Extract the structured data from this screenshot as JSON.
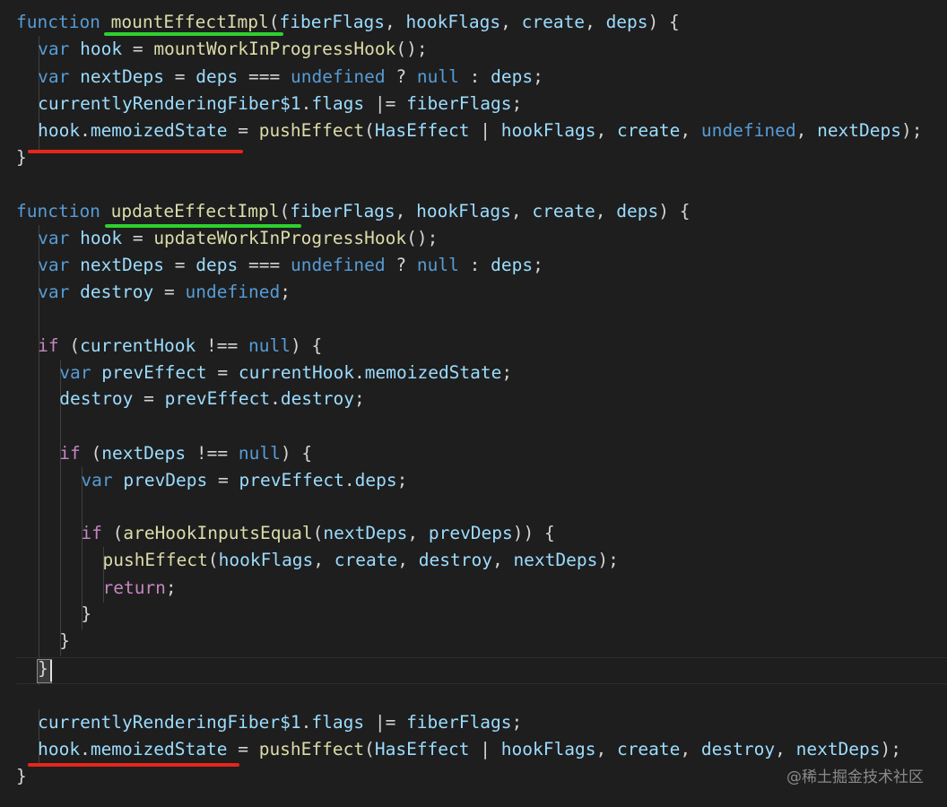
{
  "editor": {
    "lines": [
      {
        "text": "function mountEffectImpl(fiberFlags, hookFlags, create, deps) {"
      },
      {
        "text": "var hook = mountWorkInProgressHook();"
      },
      {
        "text": "var nextDeps = deps === undefined ? null : deps;"
      },
      {
        "text": "currentlyRenderingFiber$1.flags |= fiberFlags;"
      },
      {
        "text": "hook.memoizedState = pushEffect(HasEffect | hookFlags, create, undefined, nextDeps);"
      },
      {
        "text": "}"
      },
      {
        "text": ""
      },
      {
        "text": "function updateEffectImpl(fiberFlags, hookFlags, create, deps) {"
      },
      {
        "text": "var hook = updateWorkInProgressHook();"
      },
      {
        "text": "var nextDeps = deps === undefined ? null : deps;"
      },
      {
        "text": "var destroy = undefined;"
      },
      {
        "text": ""
      },
      {
        "text": "if (currentHook !== null) {"
      },
      {
        "text": "var prevEffect = currentHook.memoizedState;"
      },
      {
        "text": "destroy = prevEffect.destroy;"
      },
      {
        "text": ""
      },
      {
        "text": "if (nextDeps !== null) {"
      },
      {
        "text": "var prevDeps = prevEffect.deps;"
      },
      {
        "text": ""
      },
      {
        "text": "if (areHookInputsEqual(nextDeps, prevDeps)) {"
      },
      {
        "text": "pushEffect(hookFlags, create, destroy, nextDeps);"
      },
      {
        "text": "return;"
      },
      {
        "text": "}"
      },
      {
        "text": "}"
      },
      {
        "text": "}"
      },
      {
        "text": ""
      },
      {
        "text": "currentlyRenderingFiber$1.flags |= fiberFlags;"
      },
      {
        "text": "hook.memoizedState = pushEffect(HasEffect | hookFlags, create, destroy, nextDeps);"
      },
      {
        "text": "}"
      }
    ]
  },
  "watermark": "@稀土掘金技术社区",
  "colors": {
    "background": "#1e1e1e",
    "keyword": "#569cd6",
    "control": "#c586c0",
    "function": "#dcdcaa",
    "variable": "#9cdcfe",
    "underline_green": "#2fd02f",
    "underline_red": "#e8251b"
  }
}
